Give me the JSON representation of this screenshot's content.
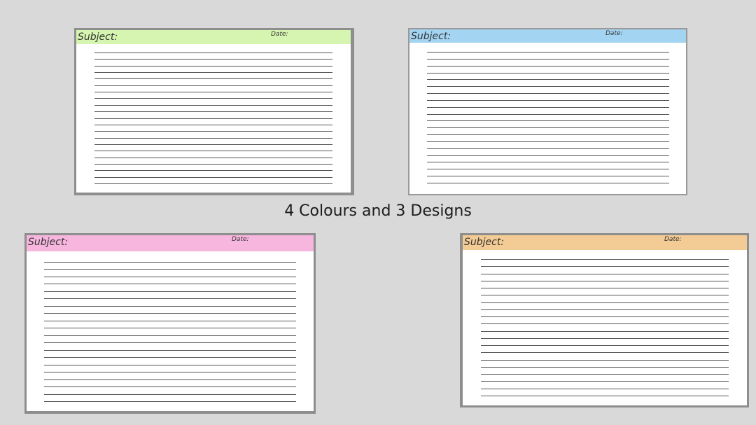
{
  "title": "4 Colours and 3 Designs",
  "cards": [
    {
      "subject_label": "Subject:",
      "date_label": "Date:",
      "header_color": "#d6f5b0",
      "line_count": 21
    },
    {
      "subject_label": "Subject:",
      "date_label": "Date:",
      "header_color": "#a3d4f2",
      "line_count": 20
    },
    {
      "subject_label": "Subject:",
      "date_label": "Date:",
      "header_color": "#f7b6dd",
      "line_count": 20
    },
    {
      "subject_label": "Subject:",
      "date_label": "Date:",
      "header_color": "#f3cb94",
      "line_count": 20
    }
  ]
}
